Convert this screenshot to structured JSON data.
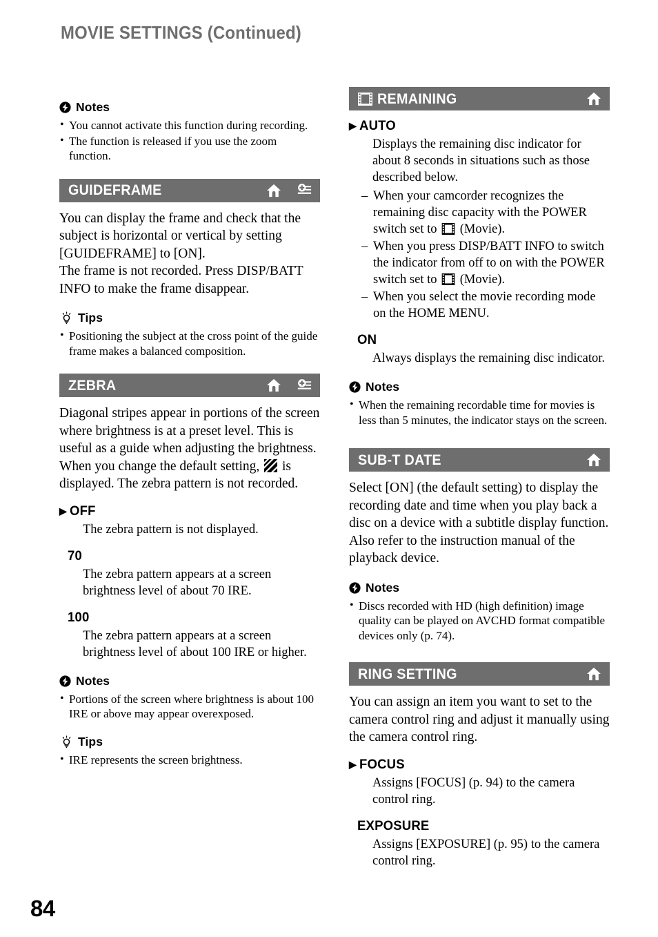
{
  "page": {
    "title": "MOVIE SETTINGS (Continued)",
    "number": "84",
    "bar_color": "#6e6e6e"
  },
  "labels": {
    "notes": "Notes",
    "tips": "Tips",
    "default_marker": "▶"
  },
  "left_column": {
    "intro_notes": {
      "heading": "Notes",
      "items": [
        "You cannot activate this function during recording.",
        "The function is released if you use the zoom function."
      ]
    },
    "guideframe": {
      "title": "GUIDEFRAME",
      "icons": [
        "home-icon",
        "options-icon"
      ],
      "paragraphs": [
        "You can display the frame and check that the subject is horizontal or vertical by setting [GUIDEFRAME] to [ON].",
        "The frame is not recorded. Press DISP/BATT INFO to make the frame disappear."
      ],
      "tips": {
        "heading": "Tips",
        "items": [
          "Positioning the subject at the cross point of the guide frame makes a balanced composition."
        ]
      }
    },
    "zebra": {
      "title": "ZEBRA",
      "icons": [
        "home-icon",
        "options-icon"
      ],
      "intro_part1": "Diagonal stripes appear in portions of the screen where brightness is at a preset level. This is useful as a guide when adjusting the brightness. When you change the default setting,",
      "intro_part2": "is displayed. The zebra pattern is not recorded.",
      "options": [
        {
          "label": "OFF",
          "default": true,
          "body": "The zebra pattern is not displayed."
        },
        {
          "label": "70",
          "default": false,
          "body": "The zebra pattern appears at a screen brightness level of about 70 IRE."
        },
        {
          "label": "100",
          "default": false,
          "body": "The zebra pattern appears at a screen brightness level of about 100 IRE or higher."
        }
      ],
      "notes": {
        "heading": "Notes",
        "items": [
          "Portions of the screen where brightness is about 100 IRE or above may appear overexposed."
        ]
      },
      "tips": {
        "heading": "Tips",
        "items": [
          "IRE represents the screen brightness."
        ]
      }
    }
  },
  "right_column": {
    "remaining": {
      "title": "REMAINING",
      "leading_icon": "film-icon",
      "icons": [
        "home-icon"
      ],
      "options": [
        {
          "label": "AUTO",
          "default": true,
          "body": "Displays the remaining disc indicator for about 8 seconds in situations such as those described below.",
          "sub_items": [
            {
              "before": "When your camcorder recognizes the remaining disc capacity with the POWER switch set to",
              "after": "(Movie)."
            },
            {
              "before": "When you press DISP/BATT INFO to switch the indicator from off to on with the POWER switch set to",
              "after": "(Movie)."
            },
            {
              "before": "When you select the movie recording mode on the HOME MENU.",
              "after": ""
            }
          ]
        },
        {
          "label": "ON",
          "default": false,
          "body": "Always displays the remaining disc indicator."
        }
      ],
      "notes": {
        "heading": "Notes",
        "items": [
          "When the remaining recordable time for movies is less than 5 minutes, the indicator stays on the screen."
        ]
      }
    },
    "sub_t_date": {
      "title": "SUB-T DATE",
      "icons": [
        "home-icon"
      ],
      "paragraphs": [
        "Select [ON] (the default setting) to display the recording date and time when you play back a disc on a device with a subtitle display function. Also refer to the instruction manual of the playback device."
      ],
      "notes": {
        "heading": "Notes",
        "items": [
          "Discs recorded with HD (high definition) image quality can be played on AVCHD format compatible devices only (p. 74)."
        ]
      }
    },
    "ring_setting": {
      "title": "RING SETTING",
      "icons": [
        "home-icon"
      ],
      "paragraphs": [
        "You can assign an item you want to set to the camera control ring and adjust it manually using the camera control ring."
      ],
      "options": [
        {
          "label": "FOCUS",
          "default": true,
          "body": "Assigns [FOCUS] (p. 94) to the camera control ring."
        },
        {
          "label": "EXPOSURE",
          "default": false,
          "body": "Assigns [EXPOSURE] (p. 95) to the camera control ring."
        }
      ]
    }
  }
}
